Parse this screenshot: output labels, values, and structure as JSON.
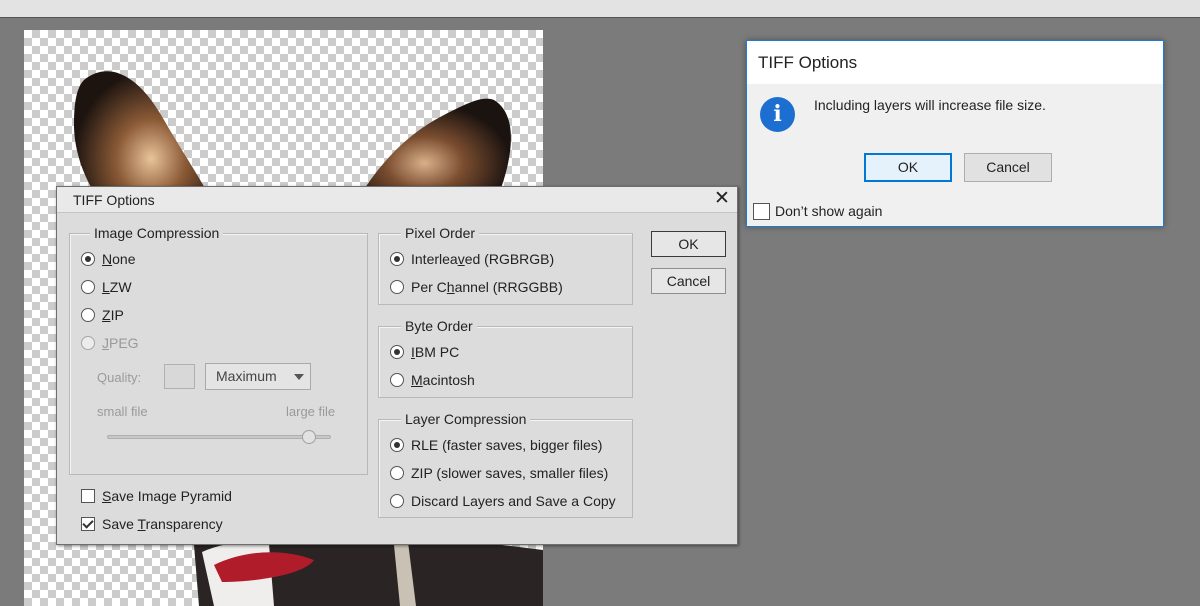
{
  "colors": {
    "accent": "#0078d7",
    "workspace_bg": "#7b7b7b",
    "dialog_bg": "#dcdcdc"
  },
  "tiff_dialog": {
    "title": "TIFF Options",
    "close_icon": "close-icon",
    "image_compression": {
      "label": "Image Compression",
      "options": [
        {
          "pre": "",
          "key": "N",
          "post": "one",
          "checked": true,
          "disabled": false
        },
        {
          "pre": "",
          "key": "L",
          "post": "ZW",
          "checked": false,
          "disabled": false
        },
        {
          "pre": "",
          "key": "Z",
          "post": "IP",
          "checked": false,
          "disabled": false
        },
        {
          "pre": "",
          "key": "J",
          "post": "PEG",
          "checked": false,
          "disabled": true
        }
      ],
      "quality_label": "Quality:",
      "quality_value": "",
      "quality_select": "Maximum",
      "small_file": "small file",
      "large_file": "large file",
      "slider_value": 0.9
    },
    "save_image_pyramid": {
      "pre": "",
      "key": "S",
      "post": "ave Image Pyramid",
      "checked": false
    },
    "save_transparency": {
      "pre": "Save ",
      "key": "T",
      "post": "ransparency",
      "checked": true
    },
    "pixel_order": {
      "label": "Pixel Order",
      "options": [
        {
          "pre": "Interlea",
          "key": "v",
          "post": "ed (RGBRGB)",
          "checked": true
        },
        {
          "pre": "Per C",
          "key": "h",
          "post": "annel (RRGGBB)",
          "checked": false
        }
      ]
    },
    "byte_order": {
      "label": "Byte Order",
      "options": [
        {
          "pre": "",
          "key": "I",
          "post": "BM PC",
          "checked": true
        },
        {
          "pre": "",
          "key": "M",
          "post": "acintosh",
          "checked": false
        }
      ]
    },
    "layer_compression": {
      "label": "Layer Compression",
      "options": [
        {
          "pre": "",
          "key": "",
          "post": "RLE (faster saves, bigger files)",
          "checked": true
        },
        {
          "pre": "",
          "key": "",
          "post": "ZIP (slower saves, smaller files)",
          "checked": false
        },
        {
          "pre": "",
          "key": "",
          "post": "Discard Layers and Save a Copy",
          "checked": false
        }
      ]
    },
    "ok_label": "OK",
    "cancel_label": "Cancel"
  },
  "message_box": {
    "title": "TIFF Options",
    "icon": "info-icon",
    "icon_glyph": "i",
    "message": "Including layers will increase file size.",
    "ok_label": "OK",
    "cancel_label": "Cancel",
    "dont_show_label": "Don’t show again",
    "dont_show_checked": false
  }
}
